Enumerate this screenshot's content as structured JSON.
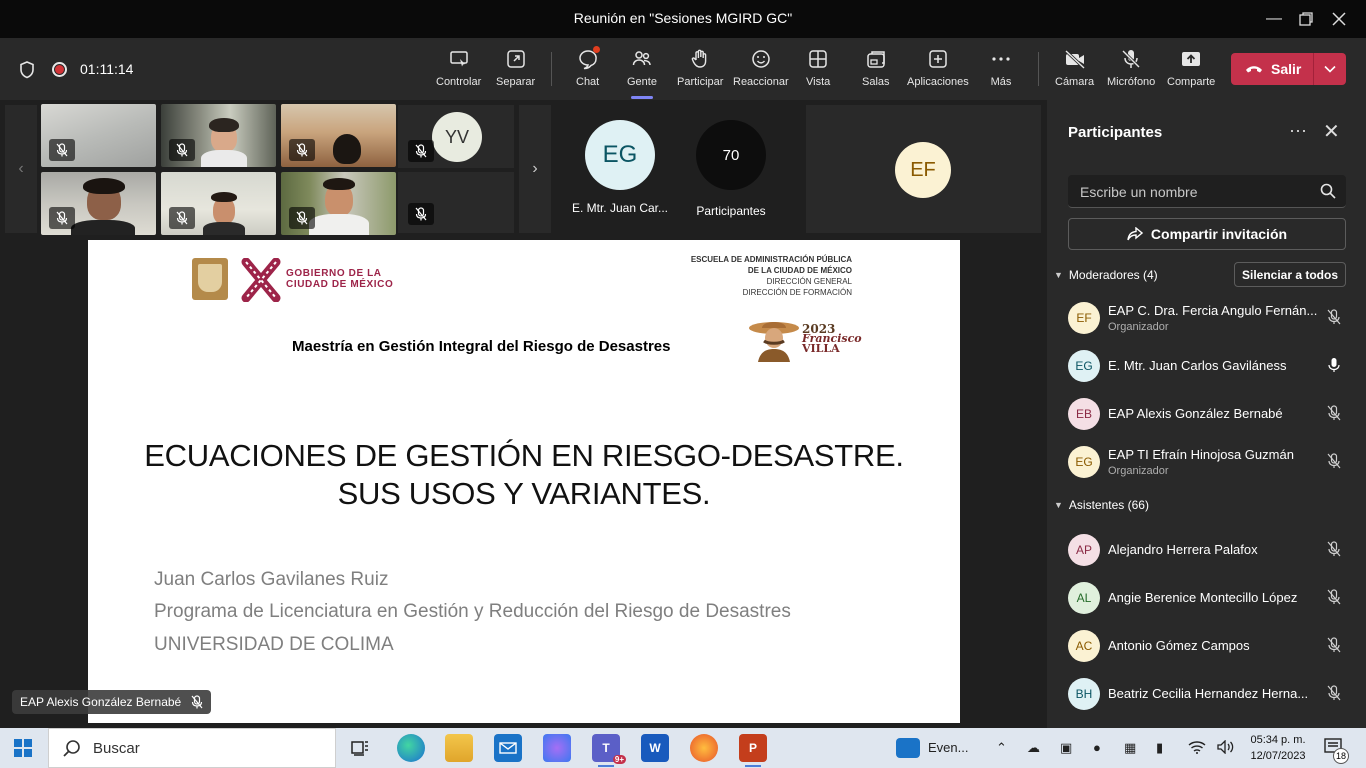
{
  "window": {
    "title": "Reunión en \"Sesiones MGIRD GC\""
  },
  "meeting": {
    "timer": "01:11:14"
  },
  "toolbar": {
    "items": [
      {
        "label": "Controlar",
        "icon": "control-icon"
      },
      {
        "label": "Separar",
        "icon": "popout-icon"
      },
      {
        "label": "Chat",
        "icon": "chat-icon"
      },
      {
        "label": "Gente",
        "icon": "people-icon"
      },
      {
        "label": "Participar",
        "icon": "raise-hand-icon"
      },
      {
        "label": "Reaccionar",
        "icon": "reaction-icon"
      },
      {
        "label": "Vista",
        "icon": "view-icon"
      },
      {
        "label": "Salas",
        "icon": "rooms-icon"
      },
      {
        "label": "Aplicaciones",
        "icon": "apps-icon"
      },
      {
        "label": "Más",
        "icon": "more-icon"
      },
      {
        "label": "Cámara",
        "icon": "camera-off-icon"
      },
      {
        "label": "Micrófono",
        "icon": "mic-off-icon"
      },
      {
        "label": "Comparte",
        "icon": "share-icon"
      }
    ],
    "leave_label": "Salir"
  },
  "gallery": {
    "yv_initials": "YV",
    "eg_initials": "EG",
    "eg_name": "E. Mtr. Juan Car...",
    "participants_count": "70",
    "participants_label": "Participantes",
    "ef_initials": "EF"
  },
  "slide": {
    "gov_line1": "GOBIERNO DE LA",
    "gov_line2": "CIUDAD DE MÉXICO",
    "school_line1": "ESCUELA DE ADMINISTRACIÓN PÚBLICA",
    "school_line2": "DE LA CIUDAD DE MÉXICO",
    "school_line3": "DIRECCIÓN GENERAL",
    "school_line4": "DIRECCIÓN DE FORMACIÓN",
    "program": "Maestría en Gestión Integral del Riesgo de Desastres",
    "villa_year": "2023",
    "villa_name1": "Francisco",
    "villa_name2": "VILLA",
    "title_line1": "ECUACIONES DE GESTIÓN EN RIESGO-DESASTRE.",
    "title_line2": "SUS USOS Y VARIANTES.",
    "author": "Juan Carlos Gavilanes Ruiz",
    "program_line": "Programa de Licenciatura en Gestión y Reducción del Riesgo de Desastres",
    "university": "UNIVERSIDAD DE COLIMA"
  },
  "presenter_tag": "EAP Alexis González Bernabé",
  "panel": {
    "title": "Participantes",
    "search_placeholder": "Escribe un nombre",
    "share_label": "Compartir invitación",
    "moderators_label": "Moderadores (4)",
    "mute_all_label": "Silenciar a todos",
    "attendees_label": "Asistentes (66)",
    "moderators": [
      {
        "initials": "EF",
        "name": "EAP C. Dra. Fercia Angulo Fernán...",
        "role": "Organizador",
        "bg": "#fbf2d3",
        "fg": "#8a5a00",
        "mic": "muted"
      },
      {
        "initials": "EG",
        "name": "E. Mtr. Juan Carlos Gaviláness",
        "role": "",
        "bg": "#dff1f4",
        "fg": "#0b5563",
        "mic": "on"
      },
      {
        "initials": "EB",
        "name": "EAP Alexis González Bernabé",
        "role": "",
        "bg": "#f4dfe5",
        "fg": "#8a2a45",
        "mic": "muted"
      },
      {
        "initials": "EG",
        "name": "EAP TI Efraín Hinojosa Guzmán",
        "role": "Organizador",
        "bg": "#fbf2d3",
        "fg": "#8a5a00",
        "mic": "muted"
      }
    ],
    "attendees": [
      {
        "initials": "AP",
        "name": "Alejandro Herrera Palafox",
        "bg": "#f4dfe5",
        "fg": "#8a2a45"
      },
      {
        "initials": "AL",
        "name": "Angie Berenice Montecillo López",
        "bg": "#e0f0dd",
        "fg": "#256b2a"
      },
      {
        "initials": "AC",
        "name": "Antonio Gómez Campos",
        "bg": "#fbf2d3",
        "fg": "#8a5a00"
      },
      {
        "initials": "BH",
        "name": "Beatriz Cecilia Hernandez Herna...",
        "bg": "#dff1f4",
        "fg": "#0b5563"
      }
    ]
  },
  "taskbar": {
    "search_label": "Buscar",
    "events_label": "Even...",
    "time": "05:34 p. m.",
    "date": "12/07/2023",
    "notification_count": "18",
    "teams_badge": "9+"
  }
}
